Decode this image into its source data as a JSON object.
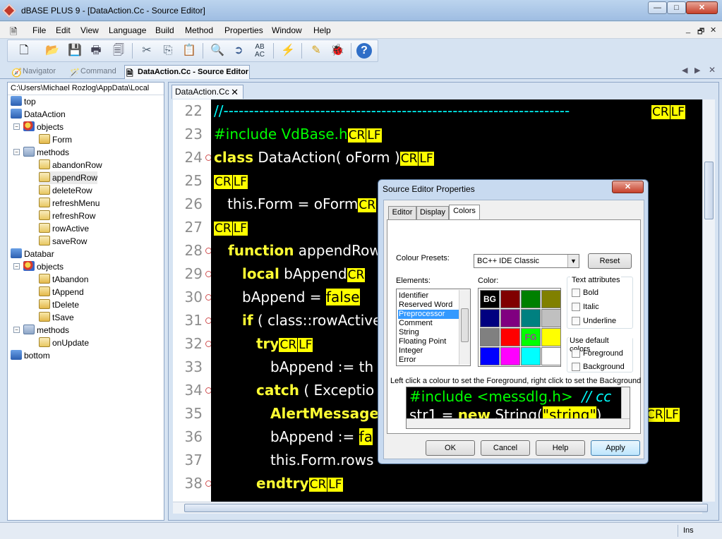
{
  "window": {
    "title": "dBASE PLUS 9 - [DataAction.Cc - Source Editor]",
    "min_label": "—",
    "max_label": "□",
    "close_label": "✕"
  },
  "menu": [
    "File",
    "Edit",
    "View",
    "Language",
    "Build",
    "Method",
    "Properties",
    "Window",
    "Help"
  ],
  "mdi": {
    "min": "_",
    "restore": "🗗",
    "close": "✕"
  },
  "toolbar_icons": [
    "new-icon",
    "open-icon",
    "save-icon",
    "print-icon",
    "print-preview-icon",
    "cut-icon",
    "copy-icon",
    "paste-icon",
    "find-icon",
    "find-next-icon",
    "replace-icon",
    "run-icon",
    "design-icon",
    "debug-icon",
    "help-icon"
  ],
  "tabs": {
    "navigator": "Navigator",
    "command": "Command",
    "source": "DataAction.Cc - Source Editor"
  },
  "tree": {
    "path": "C:\\Users\\Michael Rozlog\\AppData\\Local",
    "nodes": [
      "top",
      "DataAction",
      "objects",
      "Form",
      "methods",
      "abandonRow",
      "appendRow",
      "deleteRow",
      "refreshMenu",
      "refreshRow",
      "rowActive",
      "saveRow",
      "Databar",
      "objects",
      "tAbandon",
      "tAppend",
      "tDelete",
      "tSave",
      "methods",
      "onUpdate",
      "bottom"
    ]
  },
  "editor": {
    "file_tab": "DataAction.Cc",
    "close_label": "✕",
    "line_numbers": [
      "22",
      "23",
      "24",
      "25",
      "26",
      "27",
      "28",
      "29",
      "30",
      "31",
      "32",
      "33",
      "34",
      "35",
      "36",
      "37",
      "38"
    ],
    "crlf": {
      "cr": "CR",
      "lf": "LF"
    },
    "lines": {
      "l22": "//--------------------------------------------------------------------",
      "l23": "#include VdBase.h",
      "l24_kw": "class",
      "l24_rest": " DataAction( oForm )",
      "l26": "   this.Form = oForm",
      "l28_kw": "function",
      "l28_rest": " appendRow",
      "l29_kw": "local",
      "l29_rest": " bAppend",
      "l30_a": "bAppend = ",
      "l30_kw": "false",
      "l31_kw": "if",
      "l31_rest": " ( class::rowActive",
      "l32_kw": "try",
      "l33": "bAppend := th",
      "l34_kw": "catch",
      "l34_rest": " ( Exceptio",
      "l35_kw": "AlertMessage",
      "l36_a": "bAppend := ",
      "l36_kw": "fa",
      "l37": "this.Form.rows",
      "l38_kw": "endtry"
    }
  },
  "status": {
    "mode": "Ins"
  },
  "dialog": {
    "title": "Source Editor Properties",
    "close_label": "✕",
    "tabs": [
      "Editor",
      "Display",
      "Colors"
    ],
    "presets_label": "Colour Presets:",
    "preset_value": "BC++ IDE Classic",
    "reset_label": "Reset",
    "elements_label": "Elements:",
    "elements": [
      "Identifier",
      "Reserved Word",
      "Preprocessor",
      "Comment",
      "String",
      "Floating Point",
      "Integer",
      "Error"
    ],
    "color_label": "Color:",
    "palette": [
      "#000000",
      "#800000",
      "#008000",
      "#808000",
      "#000080",
      "#800080",
      "#008080",
      "#c0c0c0",
      "#808080",
      "#ff0000",
      "#00ff00",
      "#ffff00",
      "#0000ff",
      "#ff00ff",
      "#00ffff",
      "#ffffff"
    ],
    "bg_marker": "BG",
    "fg_marker": "FG",
    "text_attributes_label": "Text attributes",
    "bold_label": "Bold",
    "italic_label": "Italic",
    "underline_label": "Underline",
    "use_default_label": "Use default colors",
    "foreground_label": "Foreground",
    "background_label": "Background",
    "hint": "Left click a colour to set the Foreground, right click to set the Background",
    "preview": {
      "pp": "#include <messdlg.h>",
      "cm": "  // cc",
      "l2_a": "str1 = ",
      "l2_kw": "new",
      "l2_b": " String(",
      "l2_str": "\"string\"",
      "l2_c": ")"
    },
    "ok_label": "OK",
    "cancel_label": "Cancel",
    "help_label": "Help",
    "apply_label": "Apply"
  }
}
